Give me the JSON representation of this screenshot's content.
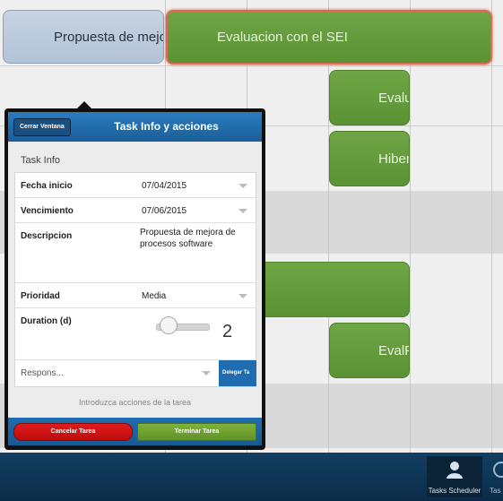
{
  "gantt": {
    "tasks": [
      {
        "label": "Propuesta de mejo",
        "state": "selected-source"
      },
      {
        "label": "Evaluacion con el SEI",
        "state": "selected"
      },
      {
        "label": "Evalu"
      },
      {
        "label": "Hiber"
      },
      {
        "label": ""
      },
      {
        "label": "EvalF"
      }
    ]
  },
  "popup": {
    "close_label": "Cerrar Ventana",
    "title": "Task Info y acciones",
    "section_header": "Task Info",
    "fields": {
      "start_label": "Fecha inicio",
      "start_value": "07/04/2015",
      "due_label": "Vencimiento",
      "due_value": "07/06/2015",
      "description_label": "Descripcion",
      "description_value": "Propuesta de mejora de procesos software",
      "priority_label": "Prioridad",
      "priority_value": "Media",
      "duration_label": "Duration (d)",
      "duration_value": "2",
      "responsible_placeholder": "Respons...",
      "delegate_label": "Delegar Ta"
    },
    "hint": "Introduzca acciones de la tarea",
    "cancel_label": "Cancelar Tarea",
    "finish_label": "Terminar Tarea"
  },
  "footer": {
    "tab_active": "Tasks Scheduler",
    "tab_next": "Tas"
  },
  "colors": {
    "task_green": "#6ea646",
    "header_blue": "#1b5e98",
    "cancel_red": "#e01b1b",
    "footer_navy": "#0b2c48"
  }
}
